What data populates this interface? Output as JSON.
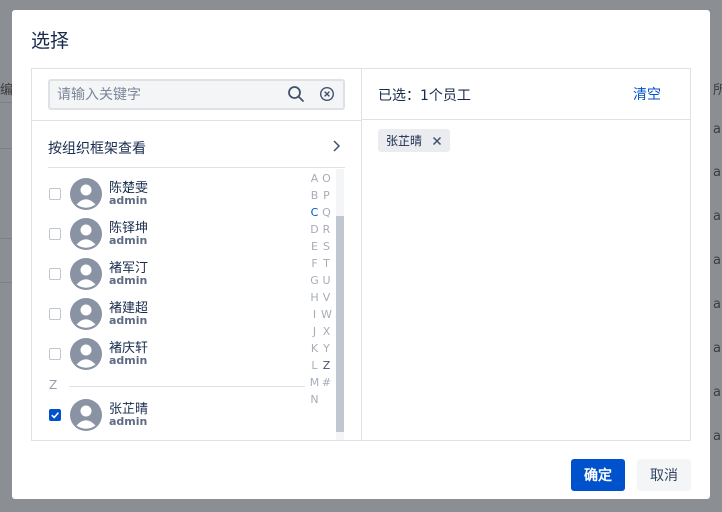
{
  "background": {
    "left_text": "编",
    "right_text": [
      "所",
      "a",
      "a",
      "a",
      "a",
      "a",
      "a",
      "a",
      "a"
    ]
  },
  "dialog": {
    "title": "选择",
    "search": {
      "placeholder": "请输入关键字",
      "value": ""
    },
    "org_browse_label": "按组织框架查看",
    "users": [
      {
        "name": "陈楚雯",
        "sub": "admin",
        "checked": false
      },
      {
        "name": "陈铎坤",
        "sub": "admin",
        "checked": false
      },
      {
        "name": "褚军汀",
        "sub": "admin",
        "checked": false
      },
      {
        "name": "褚建超",
        "sub": "admin",
        "checked": false
      },
      {
        "name": "褚庆轩",
        "sub": "admin",
        "checked": false
      },
      {
        "name": "张芷晴",
        "sub": "admin",
        "checked": true
      }
    ],
    "group_letter": "Z",
    "alpha_index_col1": [
      "A",
      "B",
      "C",
      "D",
      "E",
      "F",
      "G",
      "H",
      "I",
      "J",
      "K",
      "L",
      "M",
      "N"
    ],
    "alpha_index_col2": [
      "O",
      "P",
      "Q",
      "R",
      "S",
      "T",
      "U",
      "V",
      "W",
      "X",
      "Y",
      "Z",
      "#"
    ],
    "alpha_active": "C",
    "selected_label": "已选：1个员工",
    "clear_label": "清空",
    "selected_tags": [
      "张芷晴"
    ],
    "confirm_label": "确定",
    "cancel_label": "取消"
  },
  "colors": {
    "primary": "#0052cc",
    "overlay": "#8b8e93",
    "text": "#172b4d"
  }
}
